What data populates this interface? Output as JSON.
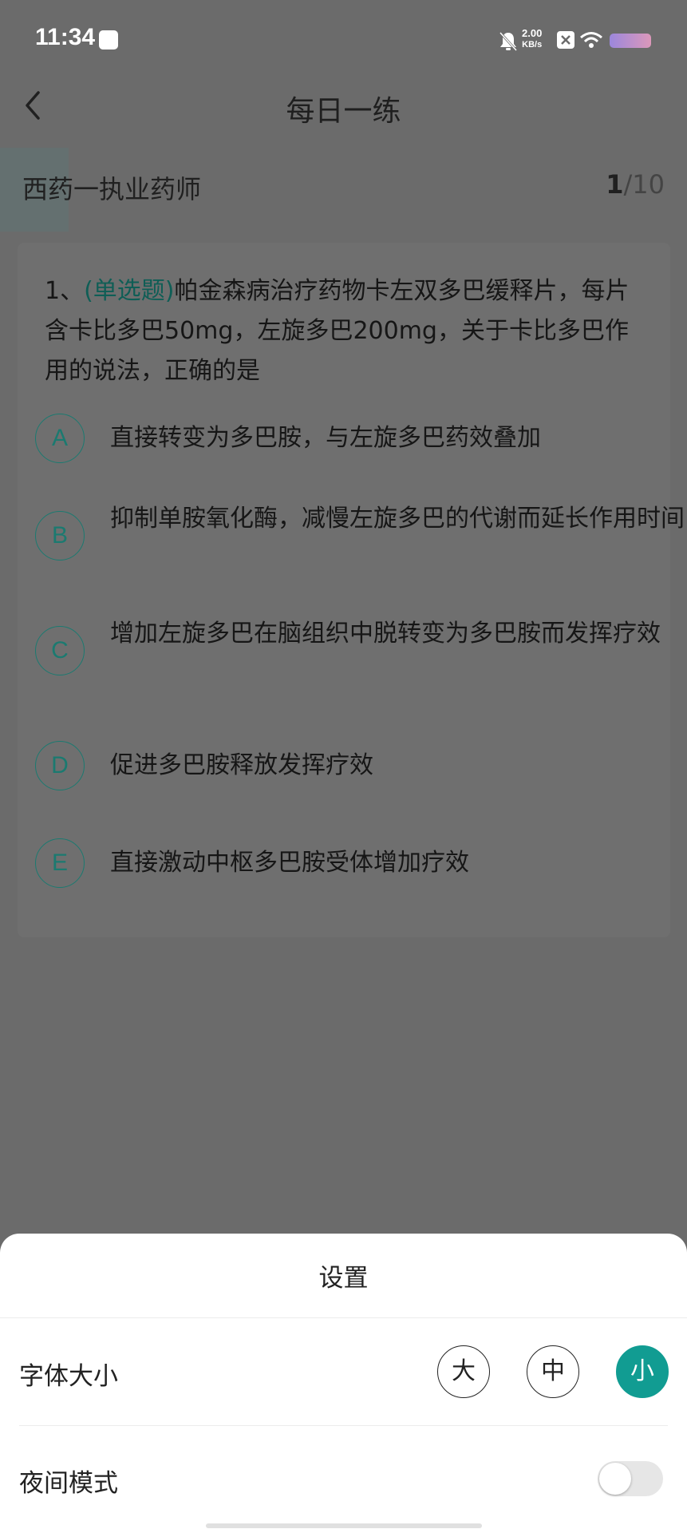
{
  "status_bar": {
    "time": "11:34",
    "speed_value": "2.00",
    "speed_unit": "KB/s"
  },
  "header": {
    "title": "每日一练",
    "subject": "西药一执业药师",
    "current": "1",
    "total": "/10"
  },
  "question": {
    "number": "1、",
    "type": "(单选题)",
    "text": "帕金森病治疗药物卡左双多巴缓释片，每片含卡比多巴50mg，左旋多巴200mg，关于卡比多巴作用的说法，正确的是",
    "options": [
      {
        "letter": "A",
        "text": "直接转变为多巴胺，与左旋多巴药效叠加"
      },
      {
        "letter": "B",
        "text": "抑制单胺氧化酶，减慢左旋多巴的代谢而延长作用时间"
      },
      {
        "letter": "C",
        "text": "增加左旋多巴在脑组织中脱转变为多巴胺而发挥疗效"
      },
      {
        "letter": "D",
        "text": "促进多巴胺释放发挥疗效"
      },
      {
        "letter": "E",
        "text": "直接激动中枢多巴胺受体增加疗效"
      }
    ]
  },
  "settings_sheet": {
    "title": "设置",
    "font_size_label": "字体大小",
    "font_size_options": [
      "大",
      "中",
      "小"
    ],
    "font_size_selected": "小",
    "night_mode_label": "夜间模式",
    "night_mode_on": false
  },
  "colors": {
    "accent": "#119c92",
    "overlay": "#6b6b6b"
  }
}
